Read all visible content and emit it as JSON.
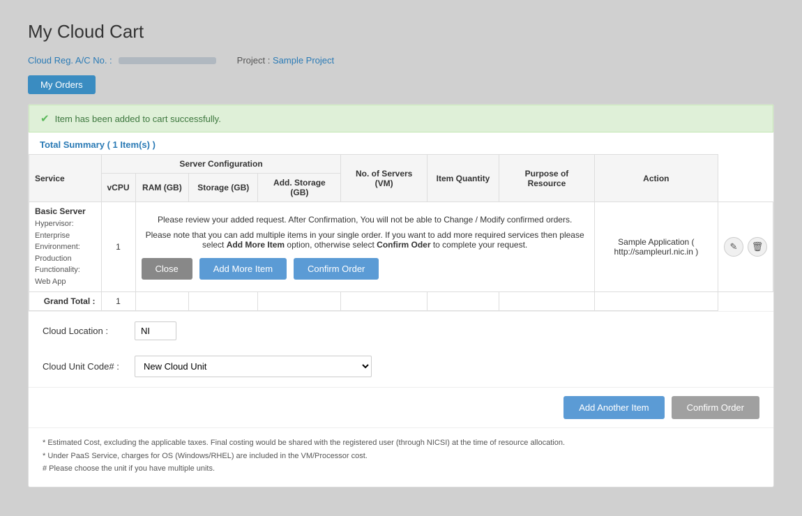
{
  "page": {
    "title": "My Cloud Cart",
    "account_label": "Cloud Reg. A/C No. :",
    "project_label": "Project :",
    "project_name": "Sample Project",
    "my_orders_btn": "My Orders"
  },
  "success": {
    "message": "Item has been added to cart successfully."
  },
  "summary": {
    "label": "Total Summary",
    "count": "( 1 Item(s) )"
  },
  "table": {
    "headers": {
      "service": "Service",
      "server_config": "Server Configuration",
      "vcpu": "vCPU",
      "ram": "RAM (GB)",
      "storage": "Storage (GB)",
      "add_storage": "Add. Storage (GB)",
      "no_of_servers": "No. of Servers (VM)",
      "item_quantity": "Item Quantity",
      "purpose": "Purpose of Resource",
      "action": "Action"
    },
    "rows": [
      {
        "service_name": "Basic Server",
        "hypervisor": "Hypervisor: Enterprise",
        "environment": "Environment: Production",
        "functionality": "Functionality: Web App",
        "vcpu": "1",
        "ram": "",
        "storage": "",
        "add_storage": "",
        "no_of_servers": "",
        "item_quantity": "",
        "purpose": "Sample Application ( http://sampleurl.nic.in )"
      }
    ],
    "grand_total": {
      "label": "Grand Total :",
      "value": "1"
    }
  },
  "popup": {
    "line1": "Please review your added request. After Confirmation, You will not be able to Change / Modify confirmed orders.",
    "line2": "Please note that you can add multiple items in your single order. If you want to add more required services then please select",
    "add_more_bold": "Add More Item",
    "line3": "option, otherwise select",
    "confirm_oder_bold": "Confirm Oder",
    "line4": "to complete your request.",
    "btn_close": "Close",
    "btn_add_more": "Add More Item",
    "btn_confirm": "Confirm Order"
  },
  "cloud_location": {
    "label": "Cloud Location :",
    "value": "NI"
  },
  "cloud_unit": {
    "label": "Cloud Unit Code# :",
    "options": [
      "New Cloud Unit"
    ],
    "selected": "New Cloud Unit"
  },
  "bottom_actions": {
    "add_another": "Add Another Item",
    "confirm_order": "Confirm Order"
  },
  "footnotes": [
    "* Estimated Cost, excluding the applicable taxes. Final costing would be shared with the registered user (through NICSI) at the time of resource allocation.",
    "* Under PaaS Service, charges for OS (Windows/RHEL) are included in the VM/Processor cost.",
    "# Please choose the unit if you have multiple units."
  ],
  "icons": {
    "edit": "✎",
    "delete": "🗑"
  }
}
